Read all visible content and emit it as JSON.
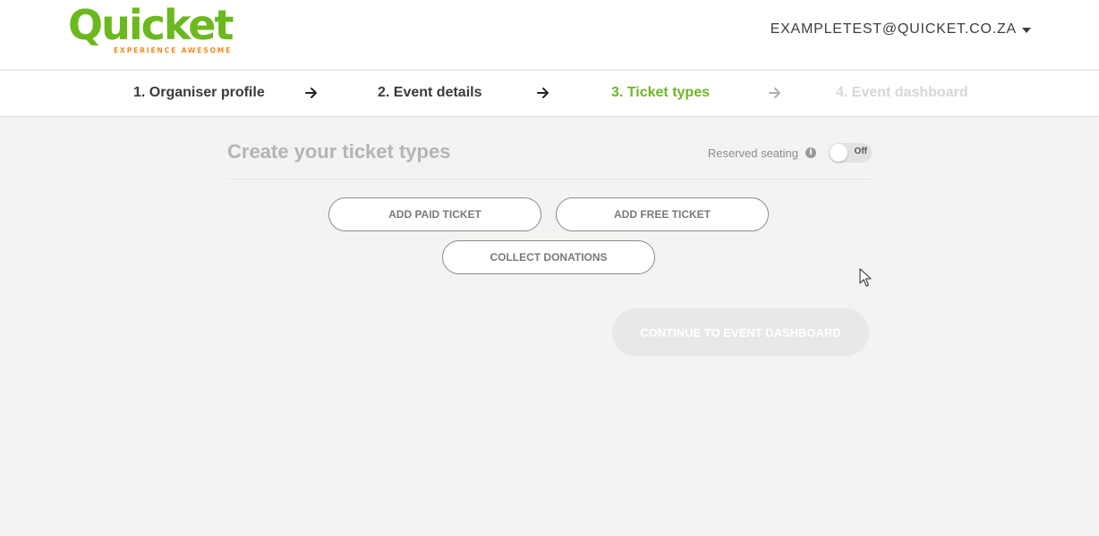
{
  "header": {
    "logo": {
      "name": "Quicket",
      "tagline": "EXPERIENCE AWESOME",
      "color": "#6cb81f",
      "tagline_color": "#f08a1d"
    },
    "account": {
      "email": "EXAMPLETEST@QUICKET.CO.ZA",
      "icon": "caret-down-icon"
    }
  },
  "steps": [
    {
      "label": "1. Organiser profile",
      "state": "done"
    },
    {
      "label": "2. Event details",
      "state": "done"
    },
    {
      "label": "3. Ticket types",
      "state": "active"
    },
    {
      "label": "4. Event dashboard",
      "state": "future"
    }
  ],
  "main": {
    "title": "Create your ticket types",
    "reserved_seating": {
      "label": "Reserved seating",
      "info_icon": "info-icon",
      "toggle_text": "Off",
      "enabled": false
    },
    "buttons": {
      "add_paid": "ADD PAID TICKET",
      "add_free": "ADD FREE TICKET",
      "collect_donations": "COLLECT DONATIONS",
      "continue": "CONTINUE TO EVENT DASHBOARD"
    }
  },
  "colors": {
    "accent": "#6cb81f",
    "background": "#f3f3f1",
    "step_done": "#3a3a3a",
    "step_future": "#d6d6d6"
  }
}
